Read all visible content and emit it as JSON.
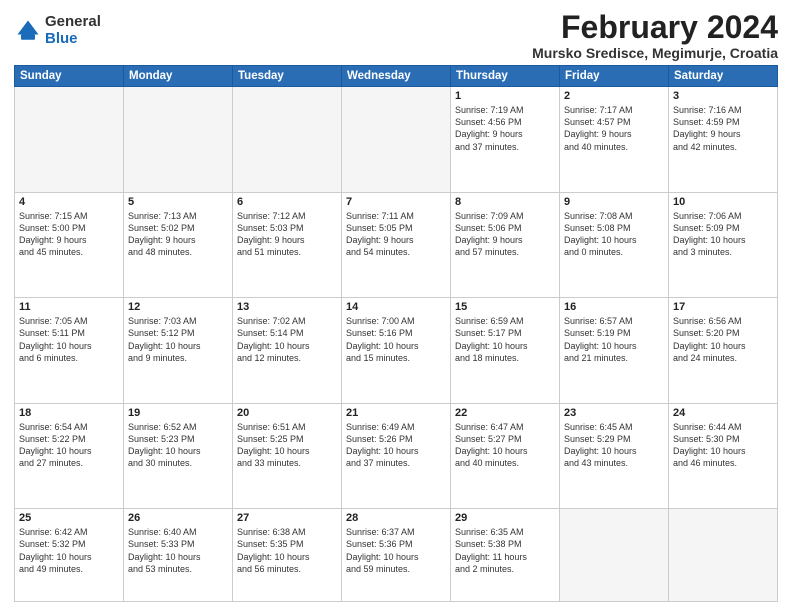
{
  "logo": {
    "general": "General",
    "blue": "Blue"
  },
  "header": {
    "title": "February 2024",
    "subtitle": "Mursko Sredisce, Megimurje, Croatia"
  },
  "days_of_week": [
    "Sunday",
    "Monday",
    "Tuesday",
    "Wednesday",
    "Thursday",
    "Friday",
    "Saturday"
  ],
  "weeks": [
    [
      {
        "date": "",
        "info": ""
      },
      {
        "date": "",
        "info": ""
      },
      {
        "date": "",
        "info": ""
      },
      {
        "date": "",
        "info": ""
      },
      {
        "date": "1",
        "info": "Sunrise: 7:19 AM\nSunset: 4:56 PM\nDaylight: 9 hours\nand 37 minutes."
      },
      {
        "date": "2",
        "info": "Sunrise: 7:17 AM\nSunset: 4:57 PM\nDaylight: 9 hours\nand 40 minutes."
      },
      {
        "date": "3",
        "info": "Sunrise: 7:16 AM\nSunset: 4:59 PM\nDaylight: 9 hours\nand 42 minutes."
      }
    ],
    [
      {
        "date": "4",
        "info": "Sunrise: 7:15 AM\nSunset: 5:00 PM\nDaylight: 9 hours\nand 45 minutes."
      },
      {
        "date": "5",
        "info": "Sunrise: 7:13 AM\nSunset: 5:02 PM\nDaylight: 9 hours\nand 48 minutes."
      },
      {
        "date": "6",
        "info": "Sunrise: 7:12 AM\nSunset: 5:03 PM\nDaylight: 9 hours\nand 51 minutes."
      },
      {
        "date": "7",
        "info": "Sunrise: 7:11 AM\nSunset: 5:05 PM\nDaylight: 9 hours\nand 54 minutes."
      },
      {
        "date": "8",
        "info": "Sunrise: 7:09 AM\nSunset: 5:06 PM\nDaylight: 9 hours\nand 57 minutes."
      },
      {
        "date": "9",
        "info": "Sunrise: 7:08 AM\nSunset: 5:08 PM\nDaylight: 10 hours\nand 0 minutes."
      },
      {
        "date": "10",
        "info": "Sunrise: 7:06 AM\nSunset: 5:09 PM\nDaylight: 10 hours\nand 3 minutes."
      }
    ],
    [
      {
        "date": "11",
        "info": "Sunrise: 7:05 AM\nSunset: 5:11 PM\nDaylight: 10 hours\nand 6 minutes."
      },
      {
        "date": "12",
        "info": "Sunrise: 7:03 AM\nSunset: 5:12 PM\nDaylight: 10 hours\nand 9 minutes."
      },
      {
        "date": "13",
        "info": "Sunrise: 7:02 AM\nSunset: 5:14 PM\nDaylight: 10 hours\nand 12 minutes."
      },
      {
        "date": "14",
        "info": "Sunrise: 7:00 AM\nSunset: 5:16 PM\nDaylight: 10 hours\nand 15 minutes."
      },
      {
        "date": "15",
        "info": "Sunrise: 6:59 AM\nSunset: 5:17 PM\nDaylight: 10 hours\nand 18 minutes."
      },
      {
        "date": "16",
        "info": "Sunrise: 6:57 AM\nSunset: 5:19 PM\nDaylight: 10 hours\nand 21 minutes."
      },
      {
        "date": "17",
        "info": "Sunrise: 6:56 AM\nSunset: 5:20 PM\nDaylight: 10 hours\nand 24 minutes."
      }
    ],
    [
      {
        "date": "18",
        "info": "Sunrise: 6:54 AM\nSunset: 5:22 PM\nDaylight: 10 hours\nand 27 minutes."
      },
      {
        "date": "19",
        "info": "Sunrise: 6:52 AM\nSunset: 5:23 PM\nDaylight: 10 hours\nand 30 minutes."
      },
      {
        "date": "20",
        "info": "Sunrise: 6:51 AM\nSunset: 5:25 PM\nDaylight: 10 hours\nand 33 minutes."
      },
      {
        "date": "21",
        "info": "Sunrise: 6:49 AM\nSunset: 5:26 PM\nDaylight: 10 hours\nand 37 minutes."
      },
      {
        "date": "22",
        "info": "Sunrise: 6:47 AM\nSunset: 5:27 PM\nDaylight: 10 hours\nand 40 minutes."
      },
      {
        "date": "23",
        "info": "Sunrise: 6:45 AM\nSunset: 5:29 PM\nDaylight: 10 hours\nand 43 minutes."
      },
      {
        "date": "24",
        "info": "Sunrise: 6:44 AM\nSunset: 5:30 PM\nDaylight: 10 hours\nand 46 minutes."
      }
    ],
    [
      {
        "date": "25",
        "info": "Sunrise: 6:42 AM\nSunset: 5:32 PM\nDaylight: 10 hours\nand 49 minutes."
      },
      {
        "date": "26",
        "info": "Sunrise: 6:40 AM\nSunset: 5:33 PM\nDaylight: 10 hours\nand 53 minutes."
      },
      {
        "date": "27",
        "info": "Sunrise: 6:38 AM\nSunset: 5:35 PM\nDaylight: 10 hours\nand 56 minutes."
      },
      {
        "date": "28",
        "info": "Sunrise: 6:37 AM\nSunset: 5:36 PM\nDaylight: 10 hours\nand 59 minutes."
      },
      {
        "date": "29",
        "info": "Sunrise: 6:35 AM\nSunset: 5:38 PM\nDaylight: 11 hours\nand 2 minutes."
      },
      {
        "date": "",
        "info": ""
      },
      {
        "date": "",
        "info": ""
      }
    ]
  ]
}
